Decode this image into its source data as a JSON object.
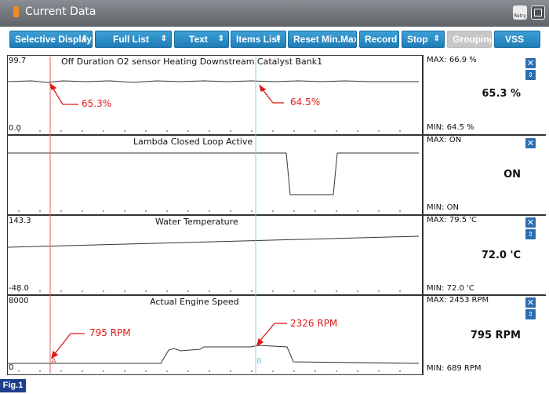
{
  "window": {
    "title": "Current Data",
    "retry_label": "Retry"
  },
  "toolbar": {
    "selective_display": "Selective Display",
    "full_list": "Full List",
    "text": "Text",
    "items_list": "Items List",
    "reset_min_max": "Reset Min.Max",
    "record": "Record",
    "stop": "Stop",
    "grouping": "Grouping",
    "vss": "VSS"
  },
  "panels": [
    {
      "title": "Off Duration O2 sensor Heating Downstream Catalyst Bank1",
      "y_max": "99.7",
      "y_min": "0.0",
      "max_label": "MAX:  66.9 %",
      "min_label": "MIN:  64.5 %",
      "current": "65.3 %"
    },
    {
      "title": "Lambda Closed Loop Active",
      "y_max": "",
      "y_min": "",
      "max_label": "MAX: ON",
      "min_label": "MIN: ON",
      "current": "ON"
    },
    {
      "title": "Water Temperature",
      "y_max": "143.3",
      "y_min": "-48.0",
      "max_label": "MAX:  79.5 'C",
      "min_label": "MIN:  72.0 'C",
      "current": "72.0 'C"
    },
    {
      "title": "Actual Engine Speed",
      "y_max": "8000",
      "y_min": "0",
      "max_label": "MAX:  2453 RPM",
      "min_label": "MIN:    689 RPM",
      "current": "795 RPM"
    }
  ],
  "annotations": {
    "a1": "65.3%",
    "a2": "64.5%",
    "a3": "795 RPM",
    "a4": "2326 RPM"
  },
  "cursors": {
    "a": "A",
    "b": "B"
  },
  "icons": {
    "close": "close-icon",
    "expand": "expand-icon"
  },
  "figure_label": "Fig.1",
  "colors": {
    "toolbar_button": "#2a86c4",
    "annotation": "#e01818",
    "cursor_a": "#e06060",
    "cursor_b": "#7ad6e0",
    "fig_badge": "#1c3e8c"
  }
}
